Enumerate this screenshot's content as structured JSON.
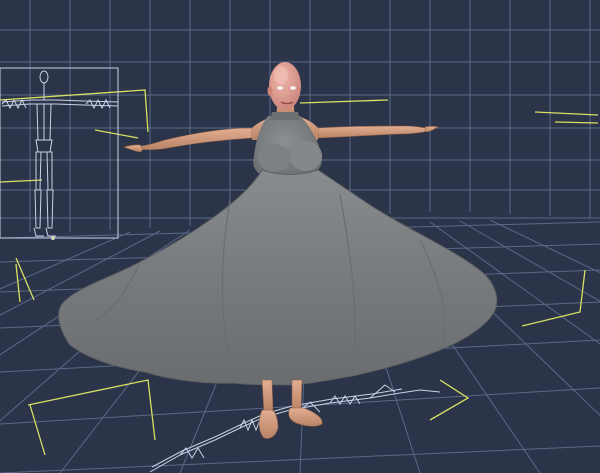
{
  "viewport": {
    "view_type": "3d-perspective",
    "background_color": "#2b3448",
    "grid_color": "#5a6a89",
    "grid_minor_color": "#3e4b66",
    "guide_color": "#d7e063",
    "skeleton_color": "#c9d2e6"
  },
  "scene": {
    "figure": {
      "pose": "t-pose",
      "skin_color": "#d8a487",
      "head_color": "#e3a59a"
    },
    "garment": {
      "type": "halter-neck dress with wide flared skirt",
      "color": "#777b7e"
    },
    "shadow_figure": {
      "type": "wireframe-skeleton",
      "pose": "standing"
    }
  }
}
